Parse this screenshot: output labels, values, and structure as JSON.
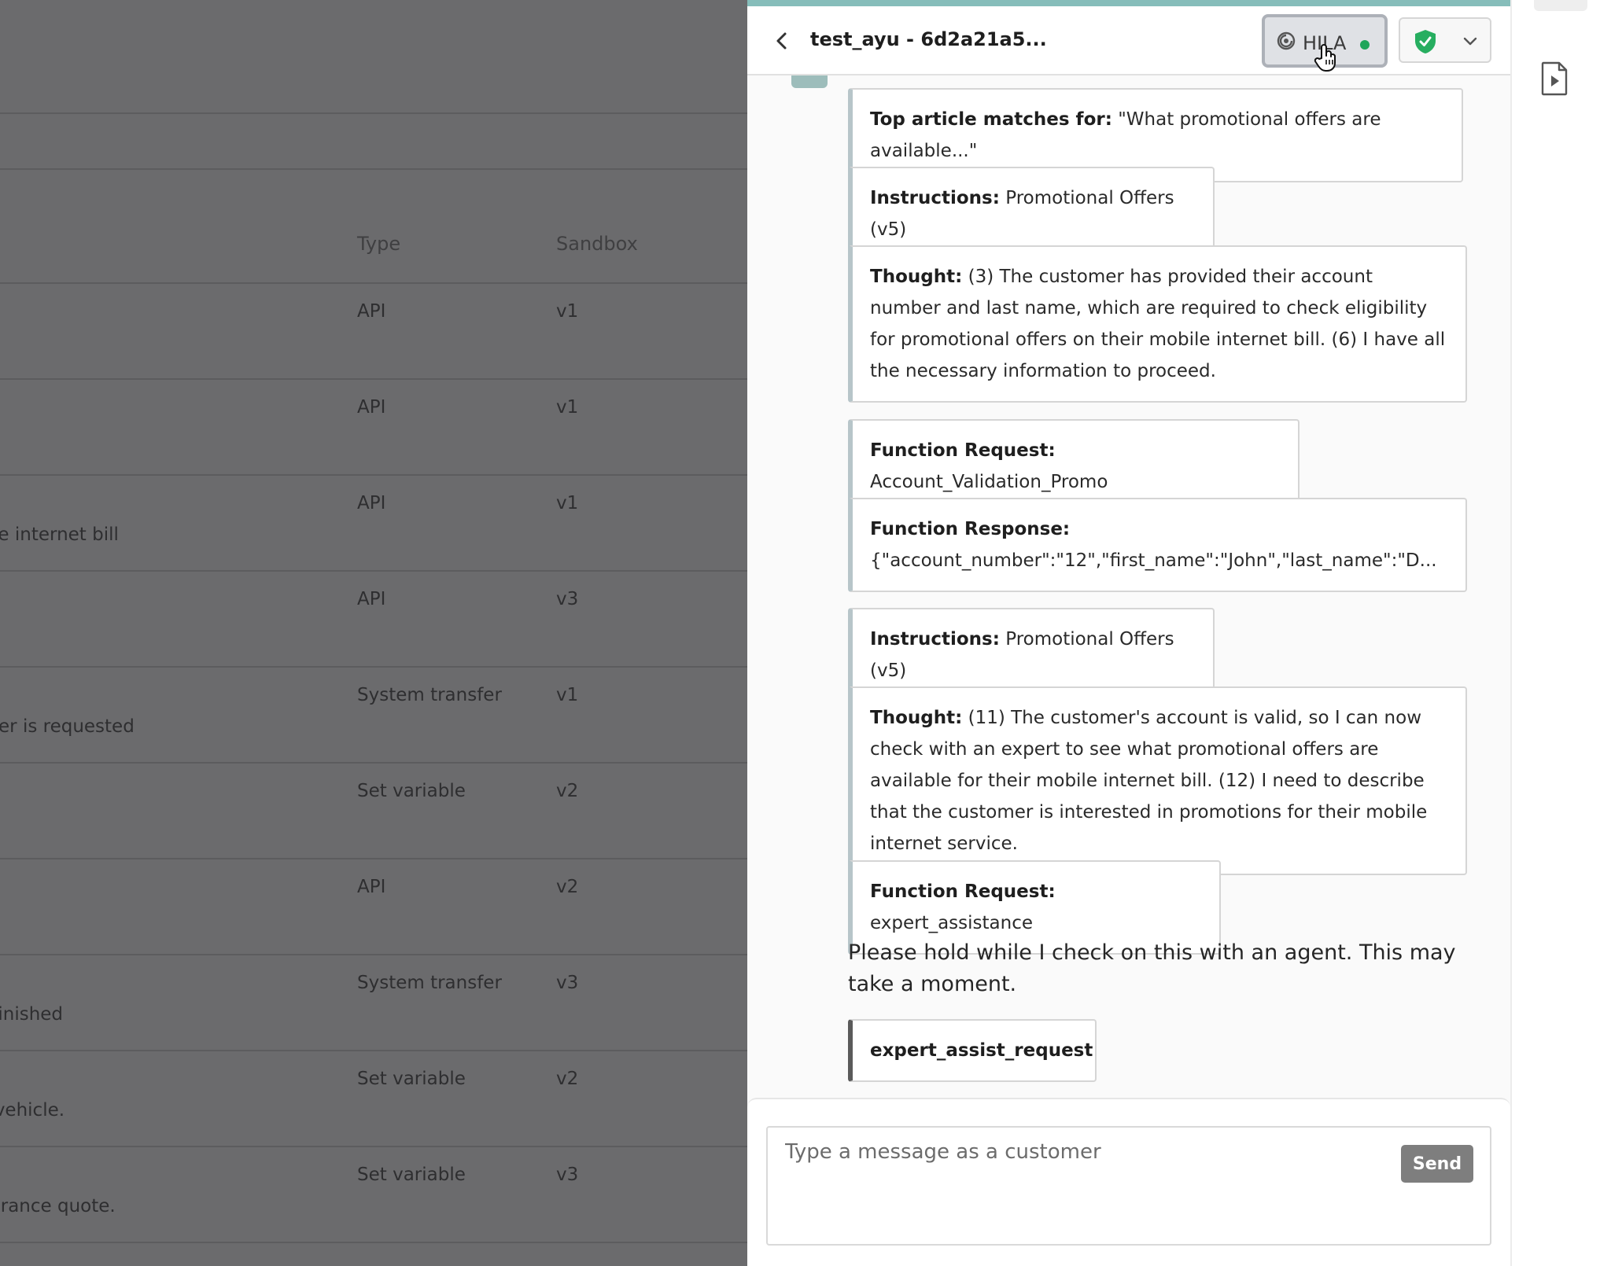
{
  "background_table": {
    "headers": {
      "type": "Type",
      "sandbox": "Sandbox"
    },
    "rows": [
      {
        "type": "API",
        "sandbox": "v1",
        "desc": ""
      },
      {
        "type": "API",
        "sandbox": "v1",
        "desc": ""
      },
      {
        "type": "API",
        "sandbox": "v1",
        "desc": "rs on their mobile internet bill"
      },
      {
        "type": "API",
        "sandbox": "v3",
        "desc": ""
      },
      {
        "type": "System transfer",
        "sandbox": "v1",
        "desc": "s finished or transfer is requested"
      },
      {
        "type": "Set variable",
        "sandbox": "v2",
        "desc": ""
      },
      {
        "type": "API",
        "sandbox": "v2",
        "desc": ""
      },
      {
        "type": "System transfer",
        "sandbox": "v3",
        "desc": "ation is finished"
      },
      {
        "type": "Set variable",
        "sandbox": "v2",
        "desc": "e user's vehicle."
      },
      {
        "type": "Set variable",
        "sandbox": "v3",
        "desc": "ng them an insurance quote."
      }
    ]
  },
  "header": {
    "title": "test_ayu - 6d2a21a5...",
    "hila_label": "HILA",
    "back_icon": "chevron-left-icon",
    "shield_icon": "shield-check-icon",
    "status_color": "#1fa55a"
  },
  "messages": [
    {
      "label": "Top article matches for:",
      "text": "\"What promotional offers are available...\""
    },
    {
      "label": "Instructions:",
      "text": "Promotional Offers (v5)"
    },
    {
      "label": "Thought:",
      "text": "(3) The customer has provided their account number and last name, which are required to check eligibility for promotional offers on their mobile internet bill. (6) I have all the necessary information to proceed."
    },
    {
      "label": "Function Request:",
      "text": "Account_Validation_Promo"
    },
    {
      "label": "Function Response:",
      "text": "{\"account_number\":\"12\",\"first_name\":\"John\",\"last_name\":\"D..."
    },
    {
      "label": "Instructions:",
      "text": "Promotional Offers (v5)"
    },
    {
      "label": "Thought:",
      "text": "(11) The customer's account is valid, so I can now check with an expert to see what promotional offers are available for their mobile internet bill. (12) I need to describe that the customer is interested in promotions for their mobile internet service."
    },
    {
      "label": "Function Request:",
      "text": "expert_assistance"
    },
    {
      "label": "",
      "text": "Please hold while I check on this with an agent. This may take a moment."
    },
    {
      "label": "expert_assist_request",
      "text": ""
    }
  ],
  "composer": {
    "placeholder": "Type a message as a customer",
    "send_label": "Send"
  },
  "rail": {
    "icon": "video-file-icon"
  }
}
